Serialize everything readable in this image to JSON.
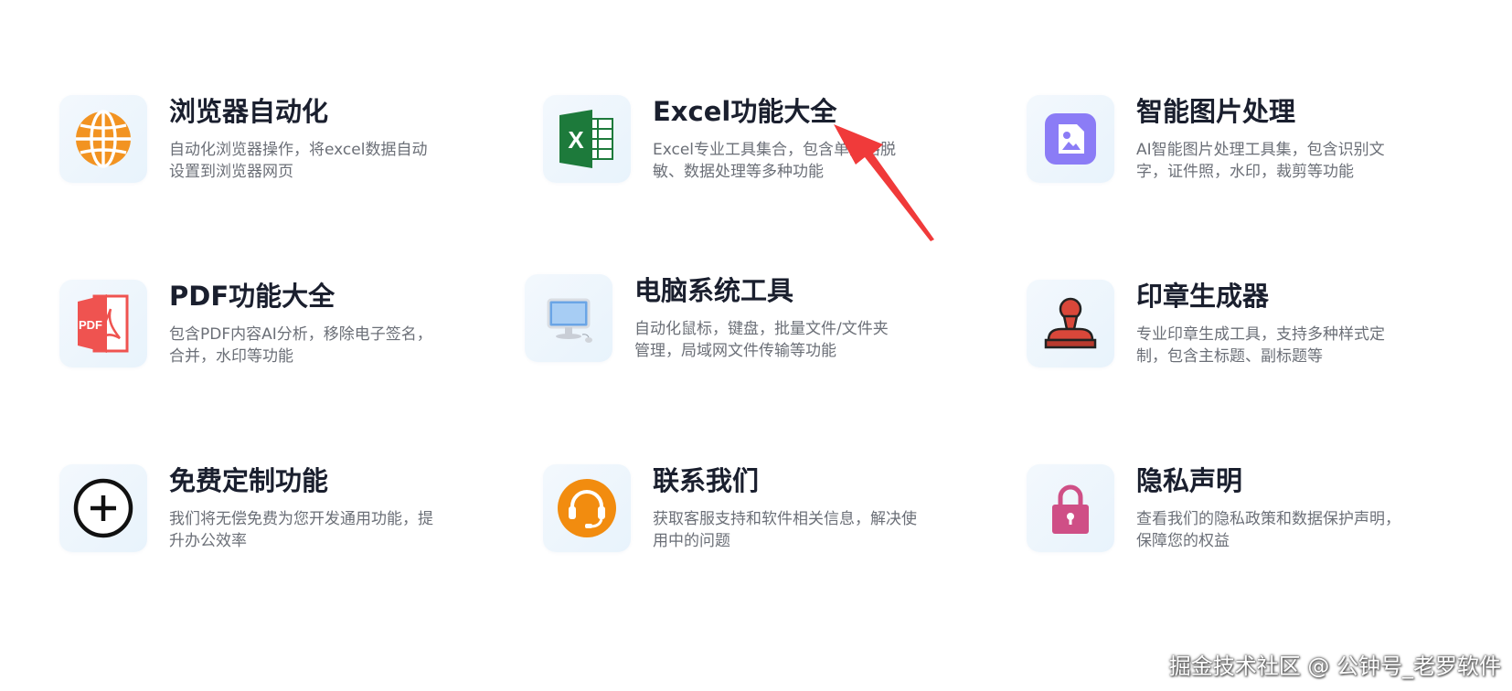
{
  "cards": [
    {
      "title": "浏览器自动化",
      "desc": "自动化浏览器操作，将excel数据自动设置到浏览器网页",
      "icon": "globe-icon"
    },
    {
      "title": "Excel功能大全",
      "desc": "Excel专业工具集合，包含单元格脱敏、数据处理等多种功能",
      "icon": "excel-icon"
    },
    {
      "title": "智能图片处理",
      "desc": "AI智能图片处理工具集，包含识别文字，证件照，水印，裁剪等功能",
      "icon": "image-icon"
    },
    {
      "title": "PDF功能大全",
      "desc": "包含PDF内容AI分析，移除电子签名，合并，水印等功能",
      "icon": "pdf-icon"
    },
    {
      "title": "电脑系统工具",
      "desc": "自动化鼠标，键盘，批量文件/文件夹管理，局域网文件传输等功能",
      "icon": "computer-icon"
    },
    {
      "title": "印章生成器",
      "desc": "专业印章生成工具，支持多种样式定制，包含主标题、副标题等",
      "icon": "stamp-icon"
    },
    {
      "title": "免费定制功能",
      "desc": "我们将无偿免费为您开发通用功能，提升办公效率",
      "icon": "plus-circle-icon"
    },
    {
      "title": "联系我们",
      "desc": "获取客服支持和软件相关信息，解决使用中的问题",
      "icon": "headset-icon"
    },
    {
      "title": "隐私声明",
      "desc": "查看我们的隐私政策和数据保护声明，保障您的权益",
      "icon": "lock-icon"
    }
  ],
  "icon_text": {
    "pdf": "PDF",
    "excel": "X"
  },
  "colors": {
    "globe": "#f29321",
    "excel": "#1d7a3b",
    "image": "#8b7cf6",
    "pdf": "#ef5350",
    "stamp": "#d9473a",
    "headset": "#f28c0f",
    "lock": "#cf4f86",
    "arrow": "#f03a3a"
  },
  "watermark": "掘金技术社区 @ 公钟号_老罗软件"
}
